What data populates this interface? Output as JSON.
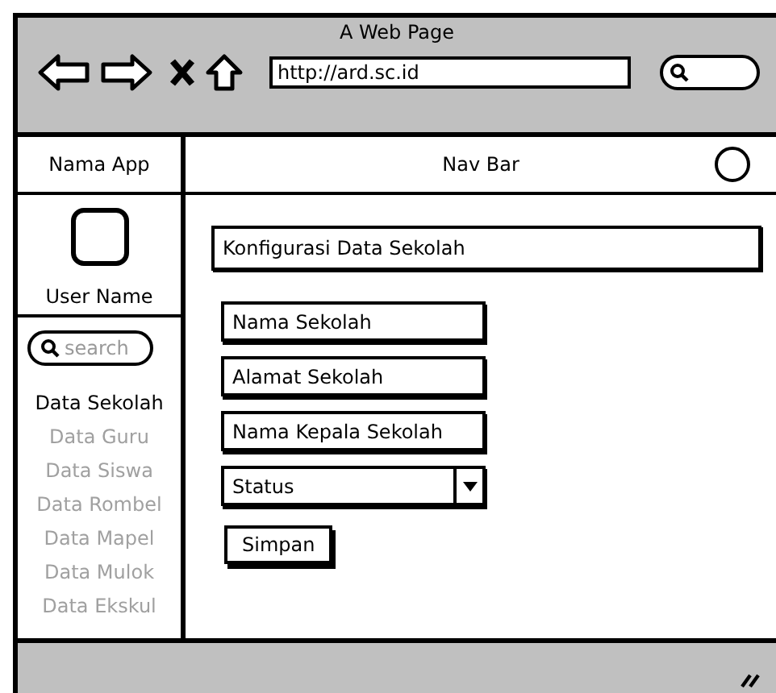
{
  "window": {
    "title": "A Web Page",
    "url": "http://ard.sc.id"
  },
  "navbar": {
    "app_name": "Nama App",
    "title": "Nav Bar"
  },
  "sidebar": {
    "user_name": "User Name",
    "search": {
      "placeholder": "search"
    },
    "items": [
      {
        "label": "Data Sekolah",
        "selected": true
      },
      {
        "label": "Data Guru",
        "selected": false
      },
      {
        "label": "Data Siswa",
        "selected": false
      },
      {
        "label": "Data Rombel",
        "selected": false
      },
      {
        "label": "Data Mapel",
        "selected": false
      },
      {
        "label": "Data Mulok",
        "selected": false
      },
      {
        "label": "Data Ekskul",
        "selected": false
      }
    ]
  },
  "form": {
    "title": "Konfigurasi Data Sekolah",
    "fields": [
      {
        "kind": "text",
        "value": "Nama Sekolah"
      },
      {
        "kind": "text",
        "value": "Alamat Sekolah"
      },
      {
        "kind": "text",
        "value": "Nama Kepala Sekolah"
      },
      {
        "kind": "select",
        "value": "Status"
      }
    ],
    "button": "Simpan"
  }
}
